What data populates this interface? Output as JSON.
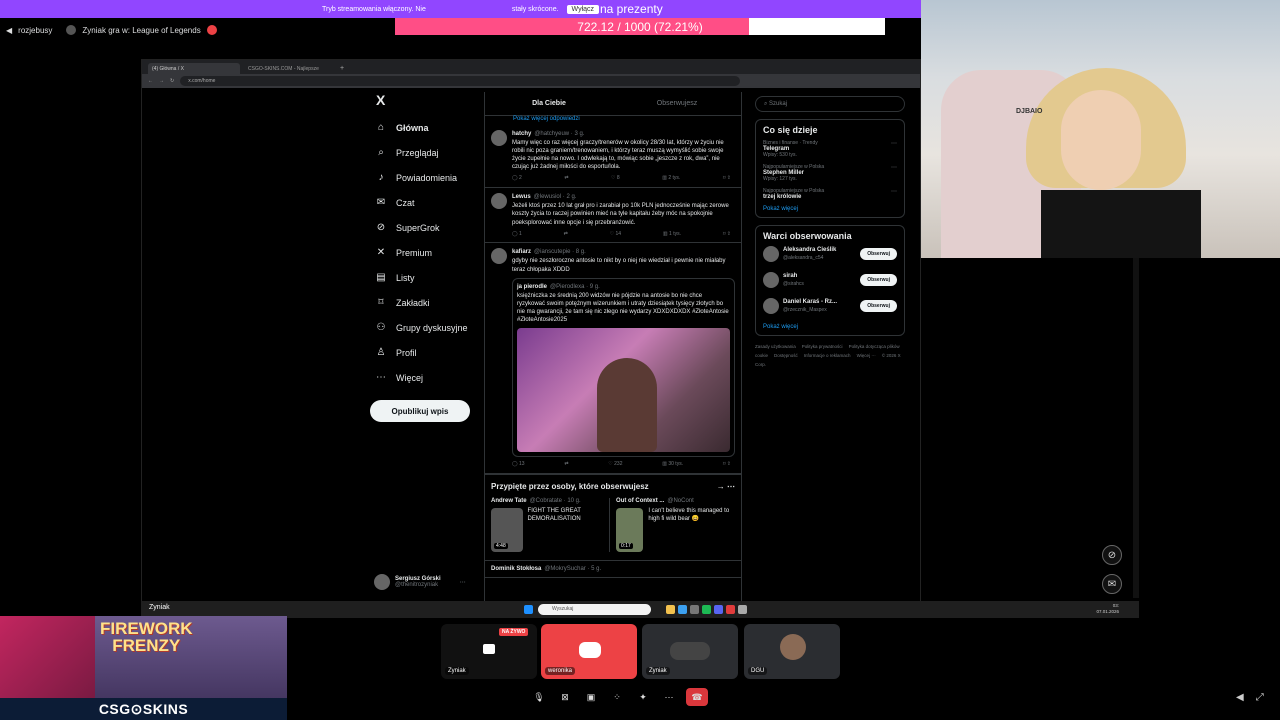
{
  "stream_banner": {
    "text": "Tryb streamowania włączony. Nie",
    "text_end": "stały skrócone.",
    "overlay": "na prezenty",
    "button": "Wyłącz"
  },
  "goal": {
    "text": "722.12 / 1000 (72.21%)",
    "progress": 0.7221
  },
  "discord_header": {
    "user": "rozjebusy",
    "activity": "Zyniak gra w: League of Legends"
  },
  "browser": {
    "tabs": [
      "(4) Główna / X",
      "CSGO-SKINS.COM - Najlepsze"
    ],
    "url": "x.com/home"
  },
  "nav": {
    "logo": "X",
    "items": [
      {
        "label": "Główna",
        "icon": "home-icon",
        "glyph": "⌂"
      },
      {
        "label": "Przeglądaj",
        "icon": "search-icon",
        "glyph": "⌕"
      },
      {
        "label": "Powiadomienia",
        "icon": "bell-icon",
        "glyph": "♪"
      },
      {
        "label": "Czat",
        "icon": "mail-icon",
        "glyph": "✉"
      },
      {
        "label": "SuperGrok",
        "icon": "grok-icon",
        "glyph": "⊘"
      },
      {
        "label": "Premium",
        "icon": "x-premium-icon",
        "glyph": "✕"
      },
      {
        "label": "Listy",
        "icon": "list-icon",
        "glyph": "▤"
      },
      {
        "label": "Zakładki",
        "icon": "bookmark-icon",
        "glyph": "⌑"
      },
      {
        "label": "Grupy dyskusyjne",
        "icon": "people-icon",
        "glyph": "⚇"
      },
      {
        "label": "Profil",
        "icon": "person-icon",
        "glyph": "♙"
      },
      {
        "label": "Więcej",
        "icon": "more-icon",
        "glyph": "⋯"
      }
    ],
    "post_button": "Opublikuj wpis",
    "profile": {
      "name": "Sergiusz Górski",
      "handle": "@thenitrozyniak"
    }
  },
  "feed": {
    "tabs": [
      "Dla Ciebie",
      "Obserwujesz"
    ],
    "show_more": "Pokaż więcej odpowiedzi",
    "tweets": [
      {
        "name": "hatchy",
        "handle": "@hatchyeuw · 3 g.",
        "text": "Mamy więc co raz więcej graczy/trenerów w okolicy 28/30 lat, którzy w życiu nie robili nic poza graniem/trenowaniem, i którzy teraz muszą wymyślić sobie swoje życie zupełnie na nowo. I odwlekają to, mówiąc sobie „jeszcze z rok, dwa”, nie czując już żadnej miłości do esportu/lola.",
        "replies": "2",
        "likes": "8",
        "views": "2 tys."
      },
      {
        "name": "Lewus",
        "handle": "@lewusiol · 2 g.",
        "text": "Jeżeli ktoś przez 10 lat grał pro i zarabiał po 10k PLN jednocześnie mając zerowe koszty życia to raczej powinien mieć na tyle kapitału żeby móc na spokojnie poeksplorować inne opcje i się przebranżowić.",
        "replies": "1",
        "likes": "14",
        "views": "1 tys."
      },
      {
        "name": "kafiarz",
        "handle": "@ianscutepie · 8 g.",
        "text": "gdyby nie zeszłoroczne antosie to nikt by o niej nie wiedział i pewnie nie miałaby teraz chłopaka XDDD",
        "replies": "13",
        "likes": "232",
        "views": "30 tys.",
        "quote": {
          "name": "ja pierodle",
          "handle": "@Pierodlexa · 9 g.",
          "text": "księżniczka ze średnią 200 widzów nie pójdzie na antosie bo nie chce ryzykować swoim potężnym wizerunkiem i utraty dziesiątek tysięcy złotych bo nie ma gwarancji, że tam się nic złego nie wydarzy XDXDXDXDX #ZłoteAntosie #ZłoteAntosie2025"
        }
      }
    ],
    "pinned_title": "Przypięte przez osoby, które obserwujesz",
    "pinned": [
      {
        "name": "Andrew Tate",
        "handle": "@Cobratate · 10 g.",
        "text": "FIGHT THE GREAT DEMORALISATION",
        "duration": "4:48"
      },
      {
        "name": "Out of Context ...",
        "handle": "@NoCont",
        "text": "I can't believe this managed to high fi wild bear 😄",
        "duration": "0:17"
      }
    ],
    "last_tweet": {
      "name": "Dominik Stokłosa",
      "handle": "@MokrySuchar · 5 g."
    }
  },
  "sidebar": {
    "search_placeholder": "Szukaj",
    "trends_title": "Co się dzieje",
    "trends": [
      {
        "cat": "Biznes i finanse · Trendy",
        "name": "Telegram",
        "count": "Wpisy: 530 tys."
      },
      {
        "cat": "Najpopularniejsze w Polska",
        "name": "Stephen Miller",
        "count": "Wpisy: 127 tys."
      },
      {
        "cat": "Najpopularniejsze w Polska",
        "name": "trzej królowie",
        "count": ""
      }
    ],
    "trends_more": "Pokaż więcej",
    "wtf_title": "Warci obserwowania",
    "wtf": [
      {
        "name": "Aleksandra Cieślik",
        "handle": "@aleksandra_c54",
        "button": "Obserwuj"
      },
      {
        "name": "sirah",
        "handle": "@sirahcs",
        "button": "Obserwuj"
      },
      {
        "name": "Daniel Karaś - Rz...",
        "handle": "@rzecznik_Maspex",
        "button": "Obserwuj"
      }
    ],
    "wtf_more": "Pokaż więcej",
    "footer": [
      "Zasady użytkowania",
      "Polityka prywatności",
      "Polityka dotycząca plików cookie",
      "Dostępność",
      "Informacje o reklamach",
      "Więcej ···",
      "© 2026 X Corp."
    ]
  },
  "taskbar": {
    "search": "Wyszukaj",
    "name": "Zyniak",
    "time": "03:",
    "date": "07.01.2026"
  },
  "webcam": {
    "chair_logo": "DJBAIO"
  },
  "game": {
    "title_line1": "FIREWORK",
    "title_line2": "FRENZY",
    "logo": "CSG⊙SKINS"
  },
  "discord_call": {
    "live": "NA ŻYWO",
    "tiles": [
      {
        "label": "Zyniak"
      },
      {
        "label": "weronika"
      },
      {
        "label": "Zyniak"
      },
      {
        "label": "DGU"
      }
    ]
  }
}
